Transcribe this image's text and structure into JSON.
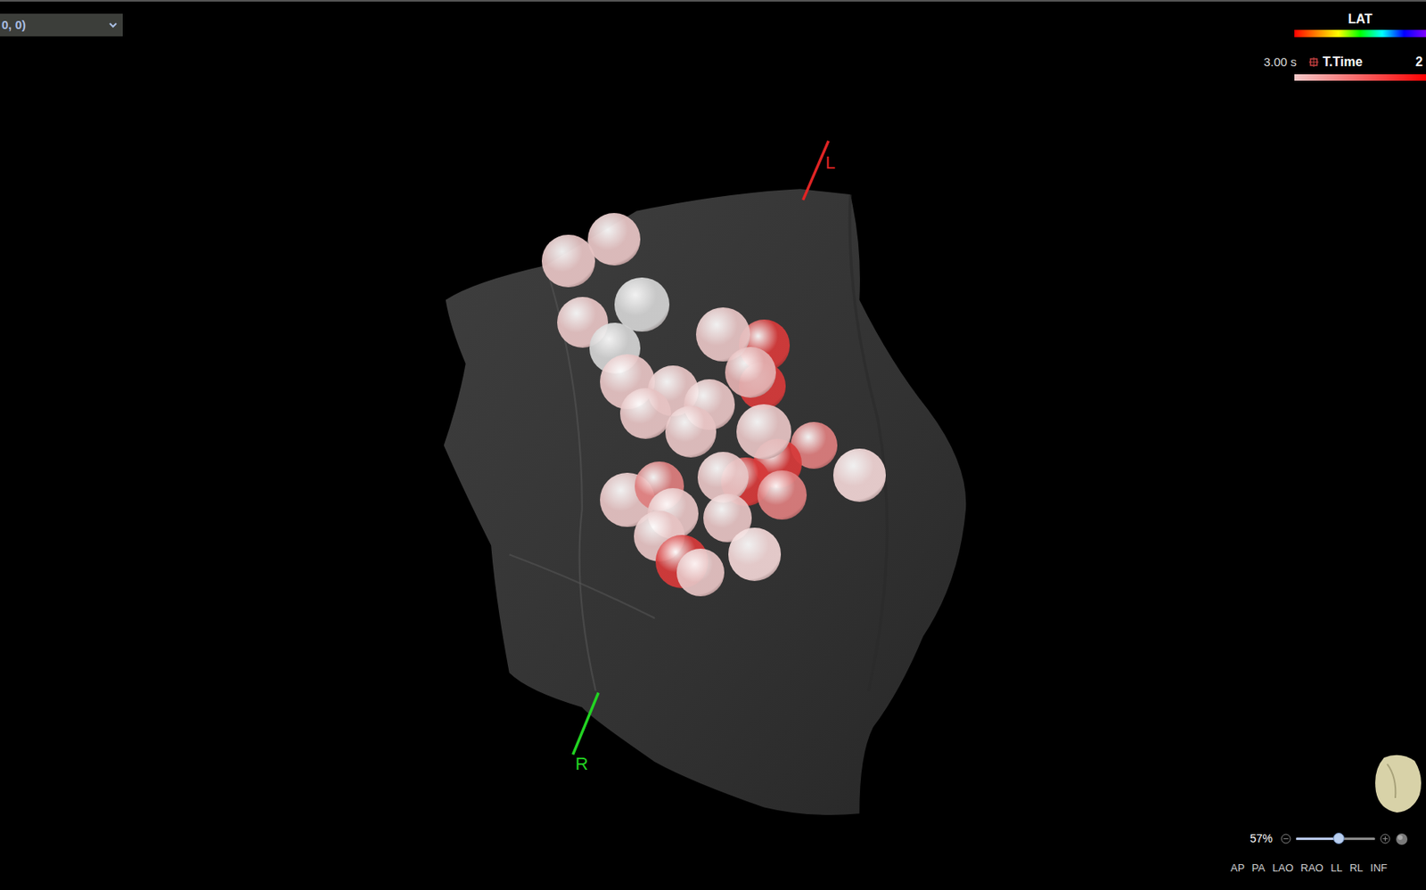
{
  "view_selector": {
    "value": "0, 0)"
  },
  "legend": {
    "lat": {
      "label": "LAT"
    },
    "ttime": {
      "min": "3.00 s",
      "label": "T.Time",
      "max": "2"
    }
  },
  "orientation_markers": [
    {
      "label": "L",
      "color": "#e02424"
    },
    {
      "label": "R",
      "color": "#22d322"
    }
  ],
  "points": [
    {
      "color": "#e6c3c3"
    },
    {
      "color": "#e6c3c3"
    },
    {
      "color": "#d2d2d2"
    },
    {
      "color": "#e6c3c3"
    },
    {
      "color": "#d2d2d2"
    },
    {
      "color": "#d63a3a"
    },
    {
      "color": "#e6c3c3"
    },
    {
      "color": "#d63a3a"
    },
    {
      "color": "#e2b0b0"
    },
    {
      "color": "#e6c3c3"
    },
    {
      "color": "#e6c3c3"
    },
    {
      "color": "#e6c3c3"
    },
    {
      "color": "#e6c3c3"
    },
    {
      "color": "#e6c3c3"
    },
    {
      "color": "#dd7e7e"
    },
    {
      "color": "#d63a3a"
    },
    {
      "color": "#e6c3c3"
    },
    {
      "color": "#f0d4d4"
    },
    {
      "color": "#d63a3a"
    },
    {
      "color": "#dd7e7e"
    },
    {
      "color": "#e6c3c3"
    },
    {
      "color": "#dd7e7e"
    },
    {
      "color": "#e6c3c3"
    },
    {
      "color": "#e6c3c3"
    },
    {
      "color": "#e6c3c3"
    },
    {
      "color": "#e6c3c3"
    },
    {
      "color": "#d63a3a"
    },
    {
      "color": "#e6c3c3"
    },
    {
      "color": "#f0d4d4"
    }
  ],
  "zoom": {
    "reading": "57%",
    "level": 0.54
  },
  "view_buttons": [
    "AP",
    "PA",
    "LAO",
    "RAO",
    "LL",
    "RL",
    "INF"
  ]
}
